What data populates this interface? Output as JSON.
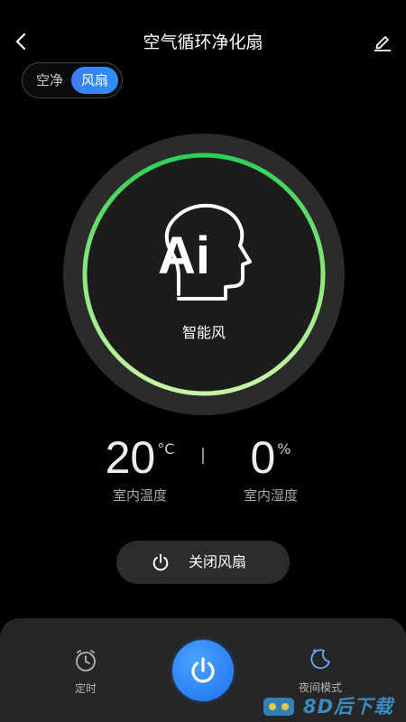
{
  "header": {
    "title": "空气循环净化扇"
  },
  "mode_toggle": {
    "options": [
      "空净",
      "风扇"
    ],
    "selected": "风扇"
  },
  "dial": {
    "ai_text": "Ai",
    "mode_label": "智能风",
    "ring_color_start": "#b6f29a",
    "ring_color_end": "#2fcf5a"
  },
  "stats": {
    "temperature": {
      "value": "20",
      "unit": "°C",
      "label": "室内温度"
    },
    "humidity": {
      "value": "0",
      "unit": "%",
      "label": "室内湿度"
    }
  },
  "off_button": {
    "label": "关闭风扇"
  },
  "bottom_bar": {
    "timer_label": "定时",
    "night_mode_label": "夜间模式"
  },
  "watermark": {
    "text": "8D后下载"
  },
  "colors": {
    "accent": "#2b8af6",
    "background": "#000000",
    "panel": "#262626"
  }
}
